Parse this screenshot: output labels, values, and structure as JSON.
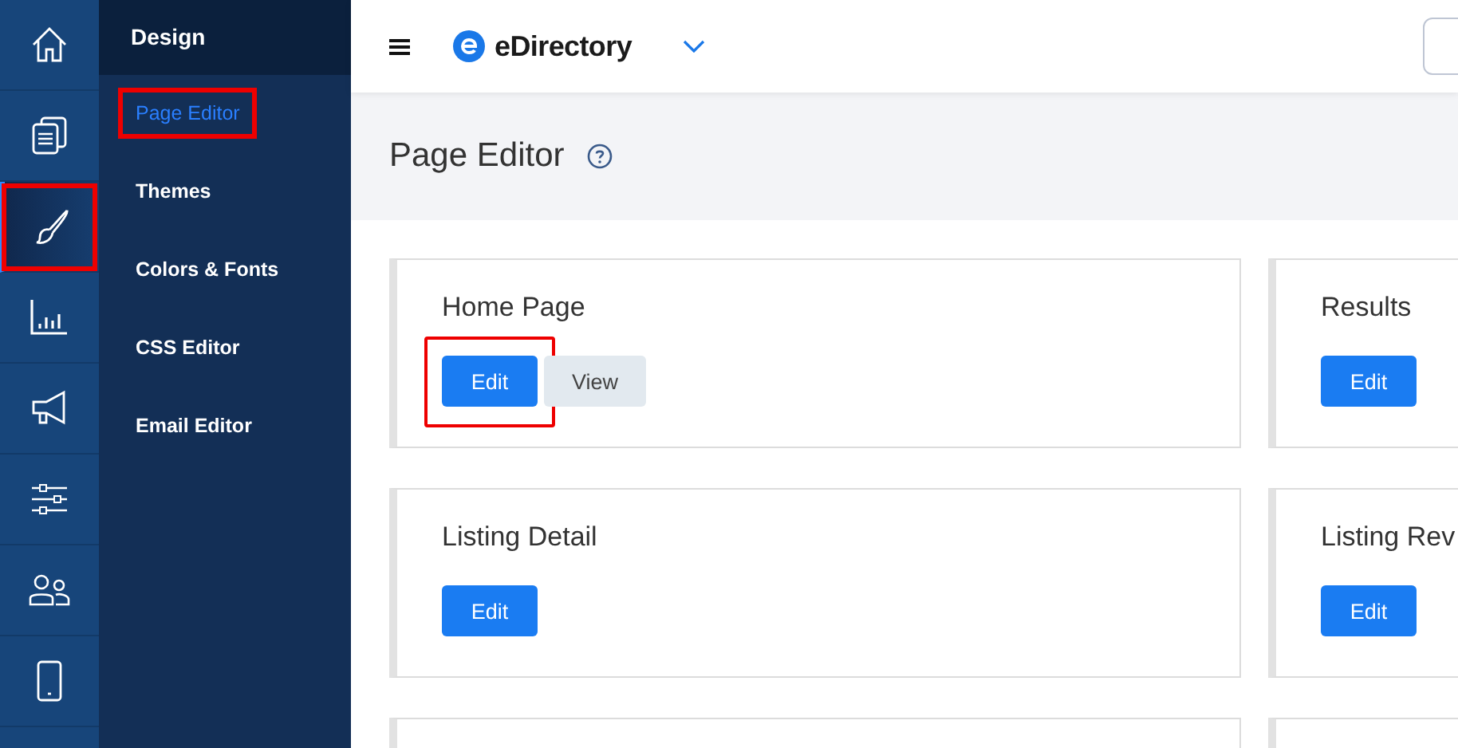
{
  "rail": [
    {
      "selected": false,
      "highlighted": false
    },
    {
      "selected": false,
      "highlighted": false
    },
    {
      "selected": true,
      "highlighted": true
    },
    {
      "selected": false,
      "highlighted": false
    },
    {
      "selected": false,
      "highlighted": false
    },
    {
      "selected": false,
      "highlighted": false
    },
    {
      "selected": false,
      "highlighted": false
    },
    {
      "selected": false,
      "highlighted": false
    }
  ],
  "submenu": {
    "title": "Design",
    "items": [
      {
        "label": "Page Editor",
        "selected": true,
        "highlighted": true
      },
      {
        "label": "Themes",
        "selected": false,
        "highlighted": false
      },
      {
        "label": "Colors & Fonts",
        "selected": false,
        "highlighted": false
      },
      {
        "label": "CSS Editor",
        "selected": false,
        "highlighted": false
      },
      {
        "label": "Email Editor",
        "selected": false,
        "highlighted": false
      }
    ]
  },
  "topbar": {
    "brand": "eDirectory"
  },
  "page": {
    "title": "Page Editor"
  },
  "cards": [
    {
      "title": "Home Page",
      "buttons": [
        {
          "label": "Edit",
          "kind": "primary",
          "highlighted": true
        },
        {
          "label": "View",
          "kind": "secondary",
          "highlighted": false
        }
      ]
    },
    {
      "title": "Results",
      "buttons": [
        {
          "label": "Edit",
          "kind": "primary",
          "highlighted": false
        }
      ]
    },
    {
      "title": "Listing Detail",
      "buttons": [
        {
          "label": "Edit",
          "kind": "primary",
          "highlighted": false
        }
      ]
    },
    {
      "title": "Listing Rev",
      "buttons": [
        {
          "label": "Edit",
          "kind": "primary",
          "highlighted": false
        }
      ]
    }
  ]
}
